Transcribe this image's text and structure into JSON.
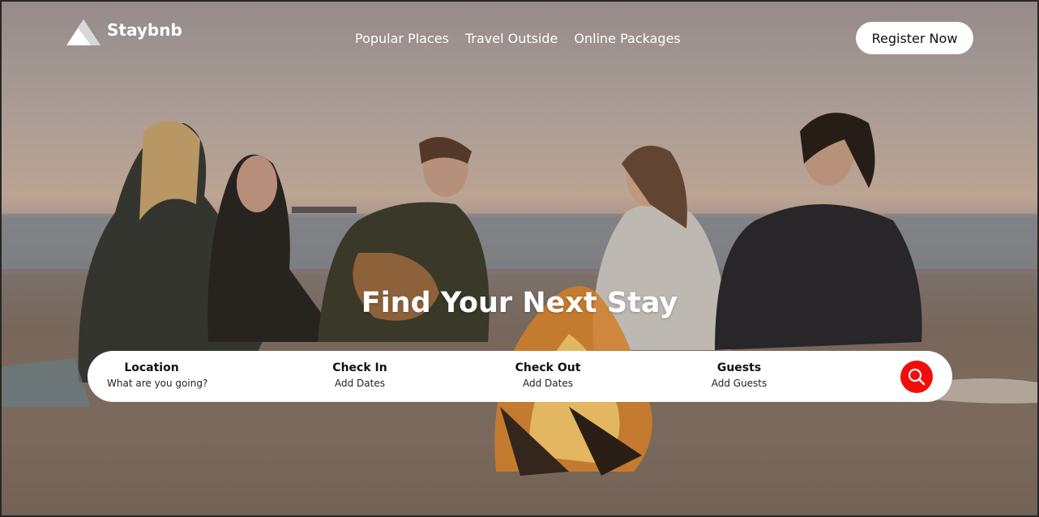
{
  "brand": {
    "name": "Staybnb",
    "logo_icon": "mountain-logo-icon"
  },
  "nav": {
    "items": [
      {
        "label": "Popular Places"
      },
      {
        "label": "Travel Outside"
      },
      {
        "label": "Online Packages"
      }
    ]
  },
  "header": {
    "register_label": "Register Now"
  },
  "hero": {
    "title": "Find Your Next Stay"
  },
  "search": {
    "location": {
      "label": "Location",
      "value": "What are you going?"
    },
    "check_in": {
      "label": "Check In",
      "value": "Add Dates"
    },
    "check_out": {
      "label": "Check Out",
      "value": "Add Dates"
    },
    "guests": {
      "label": "Guests",
      "value": "Add Guests"
    },
    "button_icon": "search-icon",
    "button_color": "#f20d0d"
  }
}
